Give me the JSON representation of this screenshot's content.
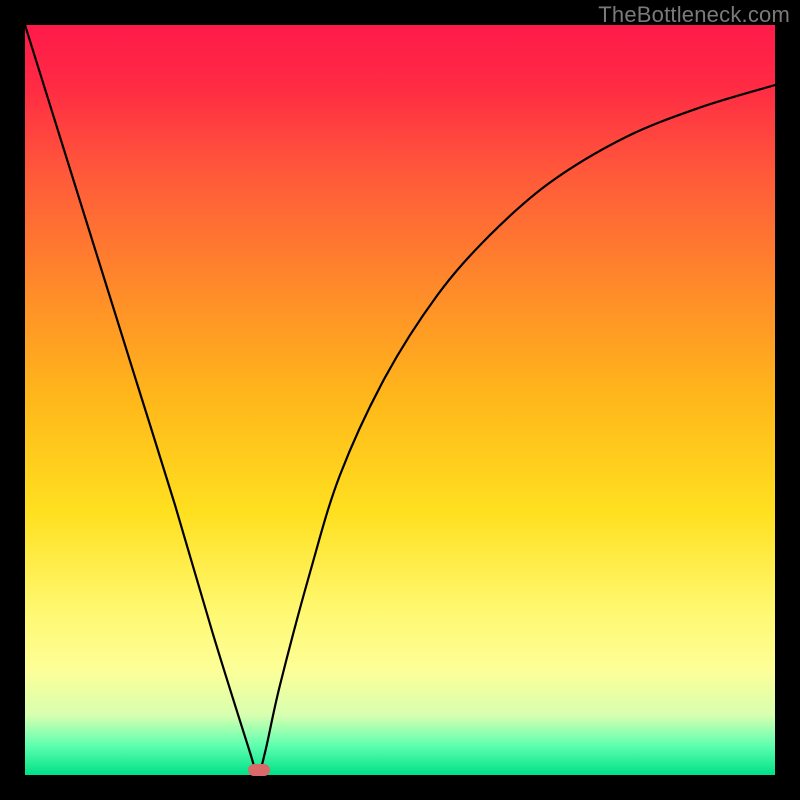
{
  "attribution": "TheBottleneck.com",
  "chart_data": {
    "type": "line",
    "title": "",
    "xlabel": "",
    "ylabel": "",
    "xlim": [
      0,
      100
    ],
    "ylim": [
      0,
      100
    ],
    "x": [
      0,
      5,
      10,
      15,
      20,
      25,
      30,
      31,
      32,
      34,
      38,
      42,
      48,
      55,
      62,
      70,
      80,
      90,
      100
    ],
    "y": [
      100,
      84,
      68,
      52,
      36,
      19,
      3,
      0,
      3,
      12,
      27,
      40,
      53,
      64,
      72,
      79,
      85,
      89,
      92
    ],
    "minimum_x": 31,
    "marker": {
      "x": 31,
      "y": 0,
      "color": "#d86a6a"
    },
    "background_gradient": [
      "#ff1a4a",
      "#ff8a2a",
      "#ffe020",
      "#fdff98",
      "#00e088"
    ],
    "legend": null,
    "grid": false
  }
}
